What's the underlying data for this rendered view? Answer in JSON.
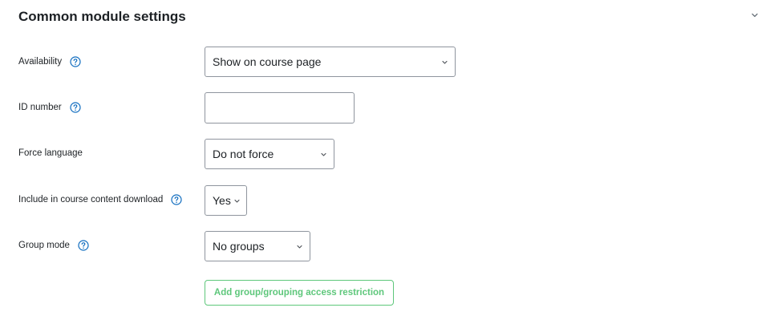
{
  "section": {
    "title": "Common module settings"
  },
  "fields": {
    "availability": {
      "label": "Availability",
      "value": "Show on course page"
    },
    "id_number": {
      "label": "ID number",
      "value": ""
    },
    "force_language": {
      "label": "Force language",
      "value": "Do not force"
    },
    "download": {
      "label": "Include in course content download",
      "value": "Yes"
    },
    "group_mode": {
      "label": "Group mode",
      "value": "No groups"
    }
  },
  "actions": {
    "restriction_label": "Add group/grouping access restriction"
  },
  "icons": {
    "help": "question-circle-icon",
    "chevron": "chevron-down-icon"
  },
  "colors": {
    "help_icon": "#0f6cbf",
    "button_accent": "#5ec77b",
    "border": "#8f959e",
    "text": "#1d2125"
  }
}
